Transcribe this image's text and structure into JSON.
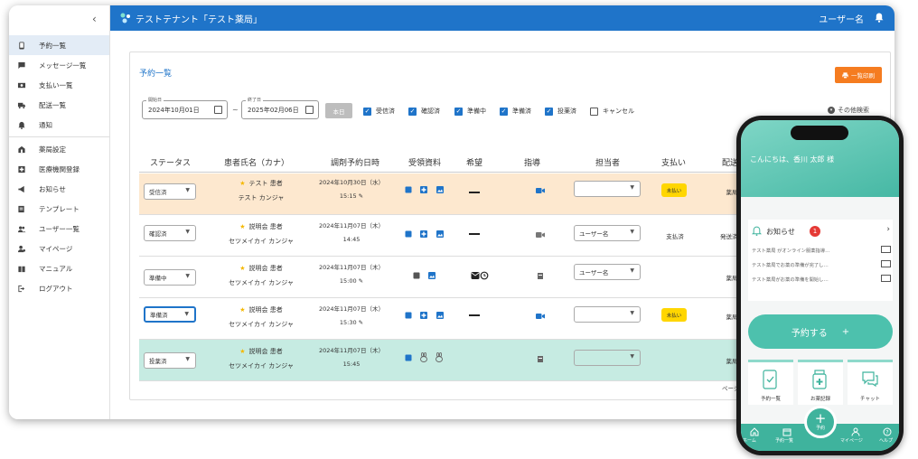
{
  "sidebar": {
    "items": [
      {
        "label": "予約一覧",
        "icon": "phone-icon"
      },
      {
        "label": "メッセージ一覧",
        "icon": "message-icon"
      },
      {
        "label": "支払い一覧",
        "icon": "payment-icon"
      },
      {
        "label": "配送一覧",
        "icon": "truck-icon"
      },
      {
        "label": "通知",
        "icon": "bell-icon"
      },
      {
        "label": "薬局設定",
        "icon": "pharmacy-icon"
      },
      {
        "label": "医療機関登録",
        "icon": "hospital-icon"
      },
      {
        "label": "お知らせ",
        "icon": "megaphone-icon"
      },
      {
        "label": "テンプレート",
        "icon": "template-icon"
      },
      {
        "label": "ユーザー一覧",
        "icon": "users-icon"
      },
      {
        "label": "マイページ",
        "icon": "mypage-icon"
      },
      {
        "label": "マニュアル",
        "icon": "manual-icon"
      },
      {
        "label": "ログアウト",
        "icon": "logout-icon"
      }
    ]
  },
  "header": {
    "tenant": "テストテナント「テスト薬局」",
    "user": "ユーザー名"
  },
  "main": {
    "title": "予約一覧",
    "print_label": "一覧印刷",
    "start_label": "開始日",
    "start_date": "2024年10月01日",
    "end_label": "終了日",
    "end_date": "2025年02月06日",
    "tilde": "~",
    "today_label": "本日",
    "filters": [
      {
        "label": "受信済",
        "checked": true
      },
      {
        "label": "確認済",
        "checked": true
      },
      {
        "label": "準備中",
        "checked": true
      },
      {
        "label": "準備済",
        "checked": true
      },
      {
        "label": "投薬済",
        "checked": true
      },
      {
        "label": "キャンセル",
        "checked": false
      }
    ],
    "other_search": "その他検索",
    "columns": [
      "ステータス",
      "患者氏名（カナ）",
      "調剤予約日時",
      "受領資料",
      "希望",
      "指導",
      "担当者",
      "支払い",
      "配送"
    ],
    "rows": [
      {
        "status": "受信済",
        "star": "",
        "name": "テスト 患者",
        "kana": "テスト カンジャ",
        "date": "2024年10月30日（水）",
        "time": "15:15",
        "staff": "",
        "payment": "未払い",
        "delivery": "薬局",
        "bg": "#fde8cf"
      },
      {
        "status": "確認済",
        "star": "★",
        "name": "説明会 患者",
        "kana": "セツメイカイ カンジャ",
        "date": "2024年11月07日（木）",
        "time": "14:45",
        "staff": "ユーザー名",
        "payment": "支払済",
        "delivery": "発送済み",
        "bg": "#ffffff"
      },
      {
        "status": "準備中",
        "star": "★",
        "name": "説明会 患者",
        "kana": "セツメイカイ カンジャ",
        "date": "2024年11月07日（木）",
        "time": "15:00",
        "staff": "ユーザー名",
        "payment": "",
        "delivery": "薬局",
        "bg": "#ffffff"
      },
      {
        "status": "準備済",
        "star": "★",
        "name": "説明会 患者",
        "kana": "セツメイカイ カンジャ",
        "date": "2024年11月07日（木）",
        "time": "15:30",
        "staff": "",
        "payment": "未払い",
        "delivery": "薬局",
        "bg": "#ffffff"
      },
      {
        "status": "投薬済",
        "star": "★",
        "name": "説明会 患者",
        "kana": "セツメイカイ カンジャ",
        "date": "2024年11月07日（木）",
        "time": "15:45",
        "staff": "",
        "payment": "",
        "delivery": "薬局",
        "bg": "#c6ebe2"
      }
    ],
    "pager": "ページあ"
  },
  "phone": {
    "greeting": "こんにちは、香川 太郎 様",
    "notice_title": "お知らせ",
    "notice_count": "1",
    "notices": [
      "テスト薬局 がオンライン服薬指導…",
      "テスト薬局でお薬の準備が完了し…",
      "テスト薬局がお薬の準備を開始し…"
    ],
    "reserve_label": "予約する",
    "reserve_plus": "+",
    "tiles": [
      "予約一覧",
      "お薬記録",
      "チャット"
    ],
    "tabs": [
      "ホーム",
      "予約一覧",
      "予約",
      "マイページ",
      "ヘルプ"
    ]
  },
  "colors": {
    "primary": "#1f74c9",
    "accent": "#f57c20",
    "unpaid": "#ffd600",
    "teal": "#3fb39d"
  }
}
